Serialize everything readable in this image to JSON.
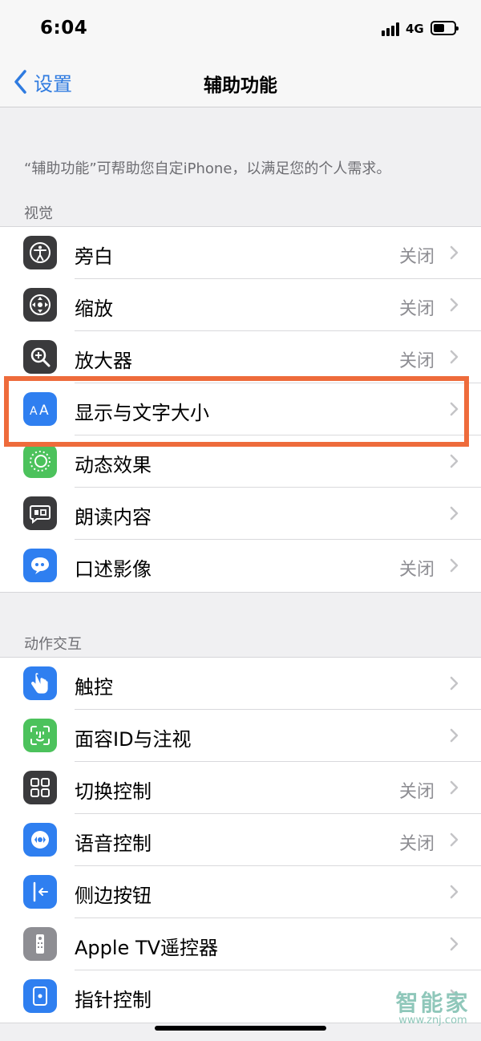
{
  "status": {
    "time": "6:04",
    "network": "4G"
  },
  "nav": {
    "back_label": "设置",
    "title": "辅助功能"
  },
  "intro": "“辅助功能”可帮助您自定iPhone，以满足您的个人需求。",
  "sections": [
    {
      "header": "视觉",
      "items": [
        {
          "label": "旁白",
          "value": "关闭",
          "icon": "voiceover-icon",
          "color": "#3a3a3c"
        },
        {
          "label": "缩放",
          "value": "关闭",
          "icon": "zoom-icon",
          "color": "#3a3a3c"
        },
        {
          "label": "放大器",
          "value": "关闭",
          "icon": "magnifier-icon",
          "color": "#3a3a3c"
        },
        {
          "label": "显示与文字大小",
          "value": "",
          "icon": "text-size-icon",
          "color": "#2f7ff0"
        },
        {
          "label": "动态效果",
          "value": "",
          "icon": "motion-icon",
          "color": "#4cc25c"
        },
        {
          "label": "朗读内容",
          "value": "",
          "icon": "spoken-content-icon",
          "color": "#3a3a3c"
        },
        {
          "label": "口述影像",
          "value": "关闭",
          "icon": "audio-description-icon",
          "color": "#2f7ff0"
        }
      ]
    },
    {
      "header": "动作交互",
      "items": [
        {
          "label": "触控",
          "value": "",
          "icon": "touch-hand-icon",
          "color": "#2f7ff0"
        },
        {
          "label": "面容ID与注视",
          "value": "",
          "icon": "face-id-icon",
          "color": "#4cc25c"
        },
        {
          "label": "切换控制",
          "value": "关闭",
          "icon": "switch-control-icon",
          "color": "#3a3a3c"
        },
        {
          "label": "语音控制",
          "value": "关闭",
          "icon": "voice-control-icon",
          "color": "#2f7ff0"
        },
        {
          "label": "侧边按钮",
          "value": "",
          "icon": "side-button-icon",
          "color": "#2f7ff0"
        },
        {
          "label": "Apple TV遥控器",
          "value": "",
          "icon": "tv-remote-icon",
          "color": "#8e8e93"
        },
        {
          "label": "指针控制",
          "value": "",
          "icon": "pointer-control-icon",
          "color": "#2f7ff0"
        }
      ]
    }
  ],
  "watermark": {
    "brand": "智能家",
    "url": "www.znj.com"
  }
}
